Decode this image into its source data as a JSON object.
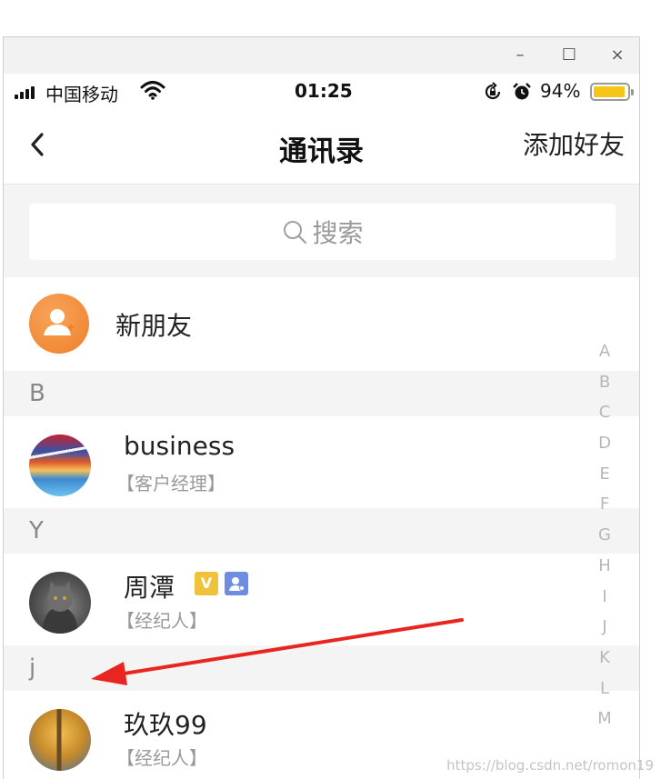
{
  "window": {
    "minimize": "–",
    "maximize": "☐",
    "close": "×"
  },
  "status_bar": {
    "carrier": "中国移动",
    "time": "01:25",
    "battery_percent": "94%",
    "battery_level": 0.94,
    "battery_color": "#f5c518"
  },
  "nav": {
    "back_icon": "chevron-left-icon",
    "title": "通讯录",
    "action": "添加好友"
  },
  "search": {
    "placeholder": "搜索"
  },
  "new_friend": {
    "label": "新朋友",
    "icon": "add-user-icon",
    "color": "#ef7f2a"
  },
  "sections": [
    {
      "letter": "B",
      "contacts": [
        {
          "name": "business",
          "role": "【客户经理】"
        }
      ]
    },
    {
      "letter": "Y",
      "contacts": [
        {
          "name": "周潭",
          "role": "【经纪人】",
          "badges": [
            "V"
          ]
        }
      ]
    },
    {
      "letter": "j",
      "contacts": [
        {
          "name": "玖玖99",
          "role": "【经纪人】"
        }
      ]
    }
  ],
  "index_letters": [
    "A",
    "B",
    "C",
    "D",
    "E",
    "F",
    "G",
    "H",
    "I",
    "J",
    "K",
    "L",
    "M"
  ],
  "annotation": {
    "arrow_color": "#e8261f"
  },
  "watermark": "https://blog.csdn.net/romon19"
}
